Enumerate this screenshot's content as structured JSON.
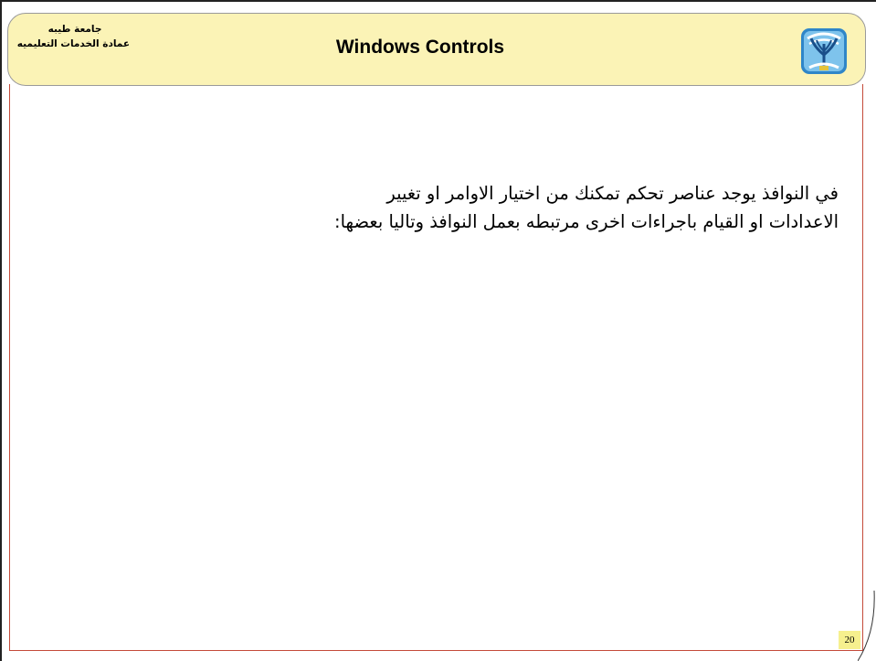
{
  "header": {
    "university_name": "جامعة طيبه",
    "deanship_name": "عمادة الخدمات التعليميه",
    "title": "Windows Controls",
    "logo_icon": "university-logo"
  },
  "content": {
    "line_1": "في النوافذ يوجد عناصر تحكم تمكنك من اختيار الاوامر او تغيير",
    "line_2": "الاعدادات او القيام باجراءات اخرى مرتبطه بعمل النوافذ  وتاليا بعضها:"
  },
  "footer": {
    "page_number": "20"
  },
  "colors": {
    "banner_background": "#fbf3b6",
    "content_border": "#c44a3a",
    "page_number_background": "#f6f08e"
  }
}
